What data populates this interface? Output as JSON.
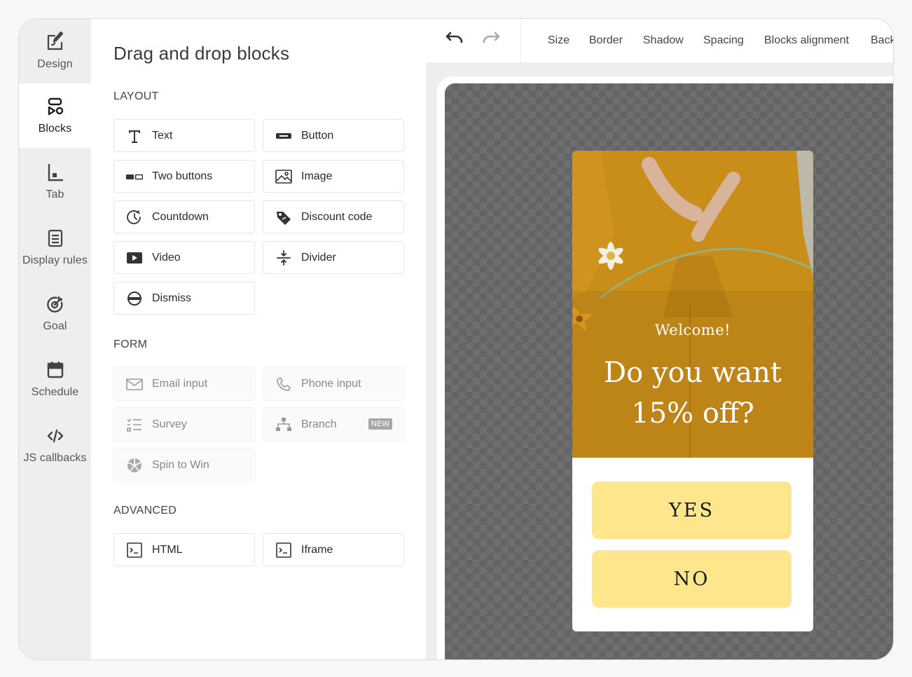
{
  "nav": {
    "items": [
      {
        "label": "Design",
        "icon": "design-icon"
      },
      {
        "label": "Blocks",
        "icon": "blocks-icon",
        "active": true
      },
      {
        "label": "Tab",
        "icon": "tab-icon"
      },
      {
        "label": "Display rules",
        "icon": "display-rules-icon"
      },
      {
        "label": "Goal",
        "icon": "goal-icon"
      },
      {
        "label": "Schedule",
        "icon": "schedule-icon"
      },
      {
        "label": "JS callbacks",
        "icon": "code-icon"
      }
    ]
  },
  "panel": {
    "title": "Drag and drop blocks",
    "layout_label": "LAYOUT",
    "layout_blocks": [
      "Text",
      "Button",
      "Two buttons",
      "Image",
      "Countdown",
      "Discount code",
      "Video",
      "Divider",
      "Dismiss"
    ],
    "form_label": "FORM",
    "form_blocks": [
      "Email input",
      "Phone input",
      "Survey",
      "Branch",
      "Spin to Win"
    ],
    "form_badge": "NEW",
    "advanced_label": "ADVANCED",
    "advanced_blocks": [
      "HTML",
      "Iframe"
    ]
  },
  "toolbar": {
    "tabs": [
      "Size",
      "Border",
      "Shadow",
      "Spacing",
      "Blocks alignment",
      "Back"
    ]
  },
  "preview": {
    "welcome": "Welcome!",
    "headline_line1": "Do you want",
    "headline_line2": "15% off?",
    "yes_label": "YES",
    "no_label": "NO",
    "button_color": "#fde68b",
    "hero_color": "#c68a17"
  }
}
